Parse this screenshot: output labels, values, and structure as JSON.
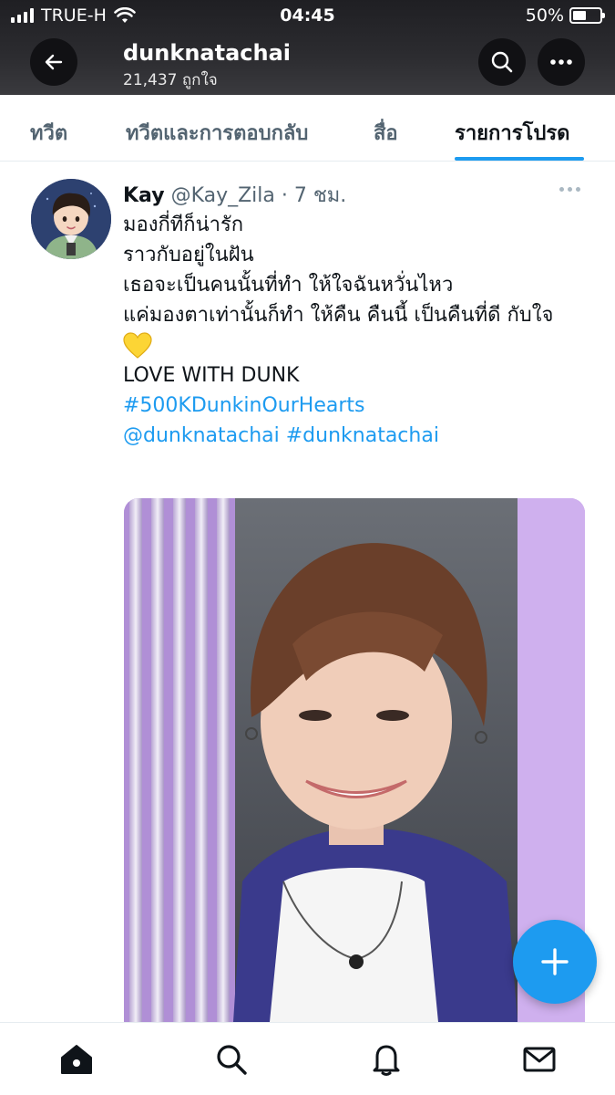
{
  "status_bar": {
    "carrier": "TRUE-H",
    "time": "04:45",
    "battery_percent": "50%",
    "battery_level": 0.5,
    "signal_icon": "signal-bars-icon",
    "wifi_icon": "wifi-icon"
  },
  "header": {
    "back_icon": "arrow-left-icon",
    "profile_name": "dunknatachai",
    "likes_count": "21,437 ถูกใจ",
    "search_icon": "search-icon",
    "more_icon": "more-horizontal-icon",
    "background_color": "#2c2c30"
  },
  "tabs": [
    {
      "label": "ทวีต",
      "active": false
    },
    {
      "label": "ทวีตและการตอบกลับ",
      "active": false
    },
    {
      "label": "สื่อ",
      "active": false
    },
    {
      "label": "รายการโปรด",
      "active": true
    }
  ],
  "tweet": {
    "display_name": "Kay",
    "meta": "@Kay_Zila · 7 ชม.",
    "lines": [
      "มองกี่ทีก็น่ารัก",
      "ราวกับอยู่ในฝัน",
      "เธอจะเป็นคนนั้นที่ทำ ให้ใจฉันหวั่นไหว",
      "แค่มองตาเท่านั้นก็ทำ ให้คืน คืนนี้ เป็นคืนที่ดี กับใจ"
    ],
    "emoji": "yellow-heart-icon",
    "caption": "LOVE WITH DUNK",
    "hashtag": "#500KDunkinOurHearts",
    "mentions": "@dunknatachai #dunknatachai",
    "media_icon": "photo-image"
  },
  "fab": {
    "icon": "compose-plus-icon"
  },
  "bottom_nav": [
    {
      "icon": "home-icon"
    },
    {
      "icon": "search-icon"
    },
    {
      "icon": "bell-icon"
    },
    {
      "icon": "mail-icon"
    }
  ],
  "colors": {
    "accent": "#1d9bf0",
    "text": "#0f1419",
    "secondary": "#536471"
  }
}
